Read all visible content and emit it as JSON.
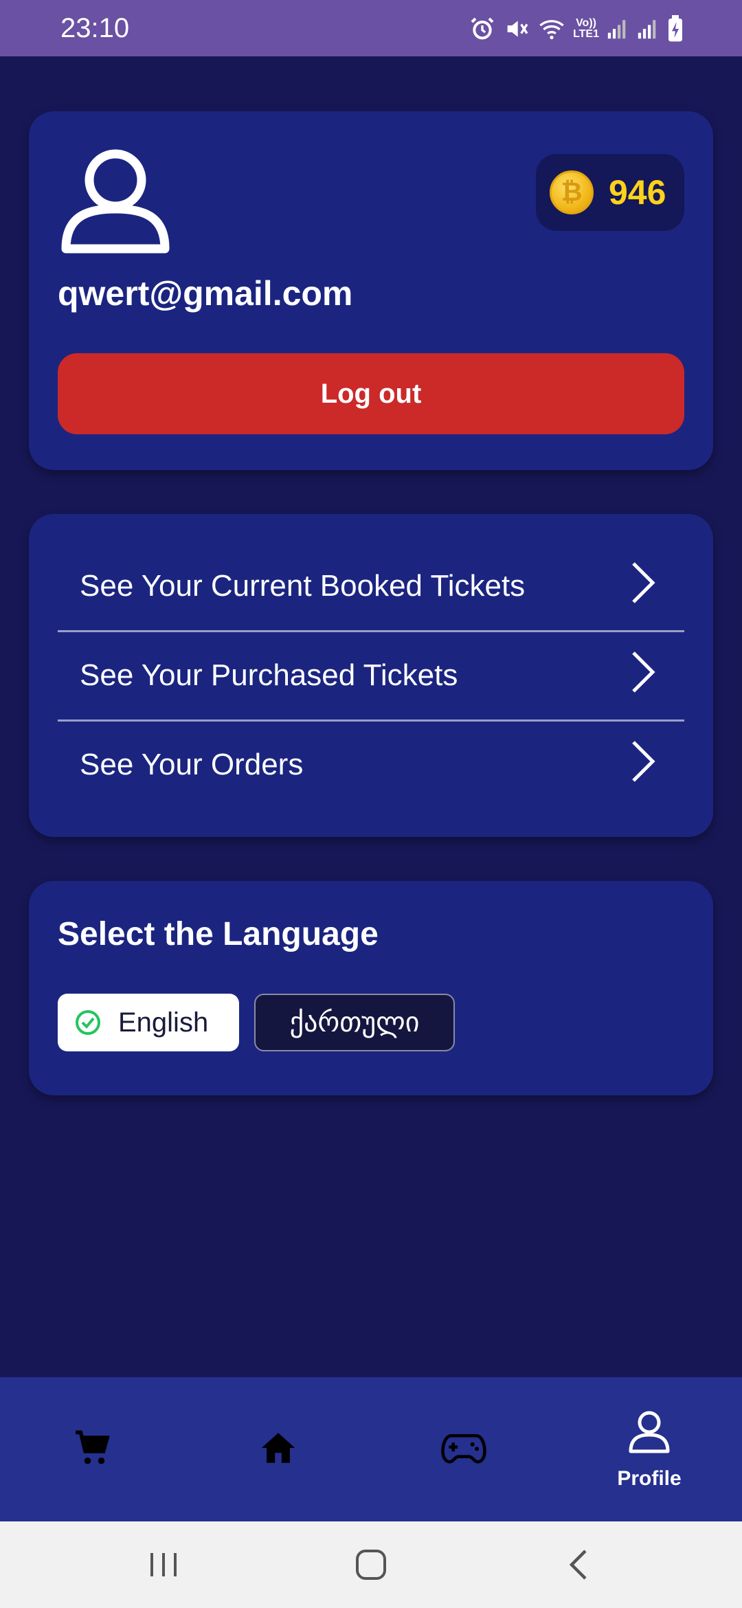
{
  "status_bar": {
    "time": "23:10",
    "network_label_top": "Vo))",
    "network_label_bottom": "LTE1",
    "icons": [
      "alarm-icon",
      "mute-icon",
      "wifi-icon",
      "signal-icon",
      "signal-icon",
      "battery-charging-icon"
    ]
  },
  "profile": {
    "avatar_icon": "user-icon",
    "coin_icon": "bitcoin-coin-icon",
    "coins": "946",
    "email": "qwert@gmail.com",
    "logout_label": "Log out"
  },
  "menu": {
    "items": [
      {
        "label": "See Your Current Booked Tickets",
        "icon": "chevron-right-icon"
      },
      {
        "label": "See Your Purchased Tickets",
        "icon": "chevron-right-icon"
      },
      {
        "label": "See Your Orders",
        "icon": "chevron-right-icon"
      }
    ]
  },
  "language": {
    "title": "Select the Language",
    "options": [
      {
        "label": "English",
        "selected": true
      },
      {
        "label": "ქართული",
        "selected": false
      }
    ]
  },
  "bottom_nav": {
    "items": [
      {
        "icon": "cart-icon",
        "label": ""
      },
      {
        "icon": "home-icon",
        "label": ""
      },
      {
        "icon": "gamepad-icon",
        "label": ""
      },
      {
        "icon": "profile-icon",
        "label": "Profile"
      }
    ],
    "active_index": 3
  },
  "colors": {
    "background": "#171756",
    "card": "#1b2580",
    "status_bar": "#6a51a3",
    "logout": "#cc2929",
    "coin_text": "#ffd21a",
    "check": "#22c55e"
  }
}
